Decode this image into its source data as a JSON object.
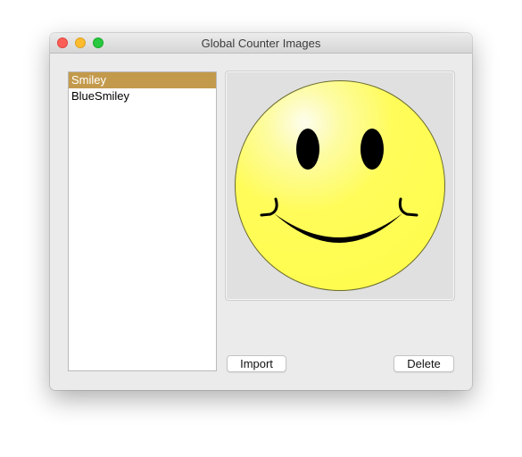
{
  "window": {
    "title": "Global Counter Images"
  },
  "image_list": {
    "items": [
      {
        "label": "Smiley",
        "selected": true
      },
      {
        "label": "BlueSmiley",
        "selected": false
      }
    ]
  },
  "preview": {
    "image": "smiley-face-icon",
    "face_color": "#fffc5a",
    "feature_color": "#000000"
  },
  "buttons": {
    "import_label": "Import",
    "delete_label": "Delete"
  },
  "colors": {
    "selection": "#c39a4c",
    "window_bg": "#ebebeb"
  }
}
